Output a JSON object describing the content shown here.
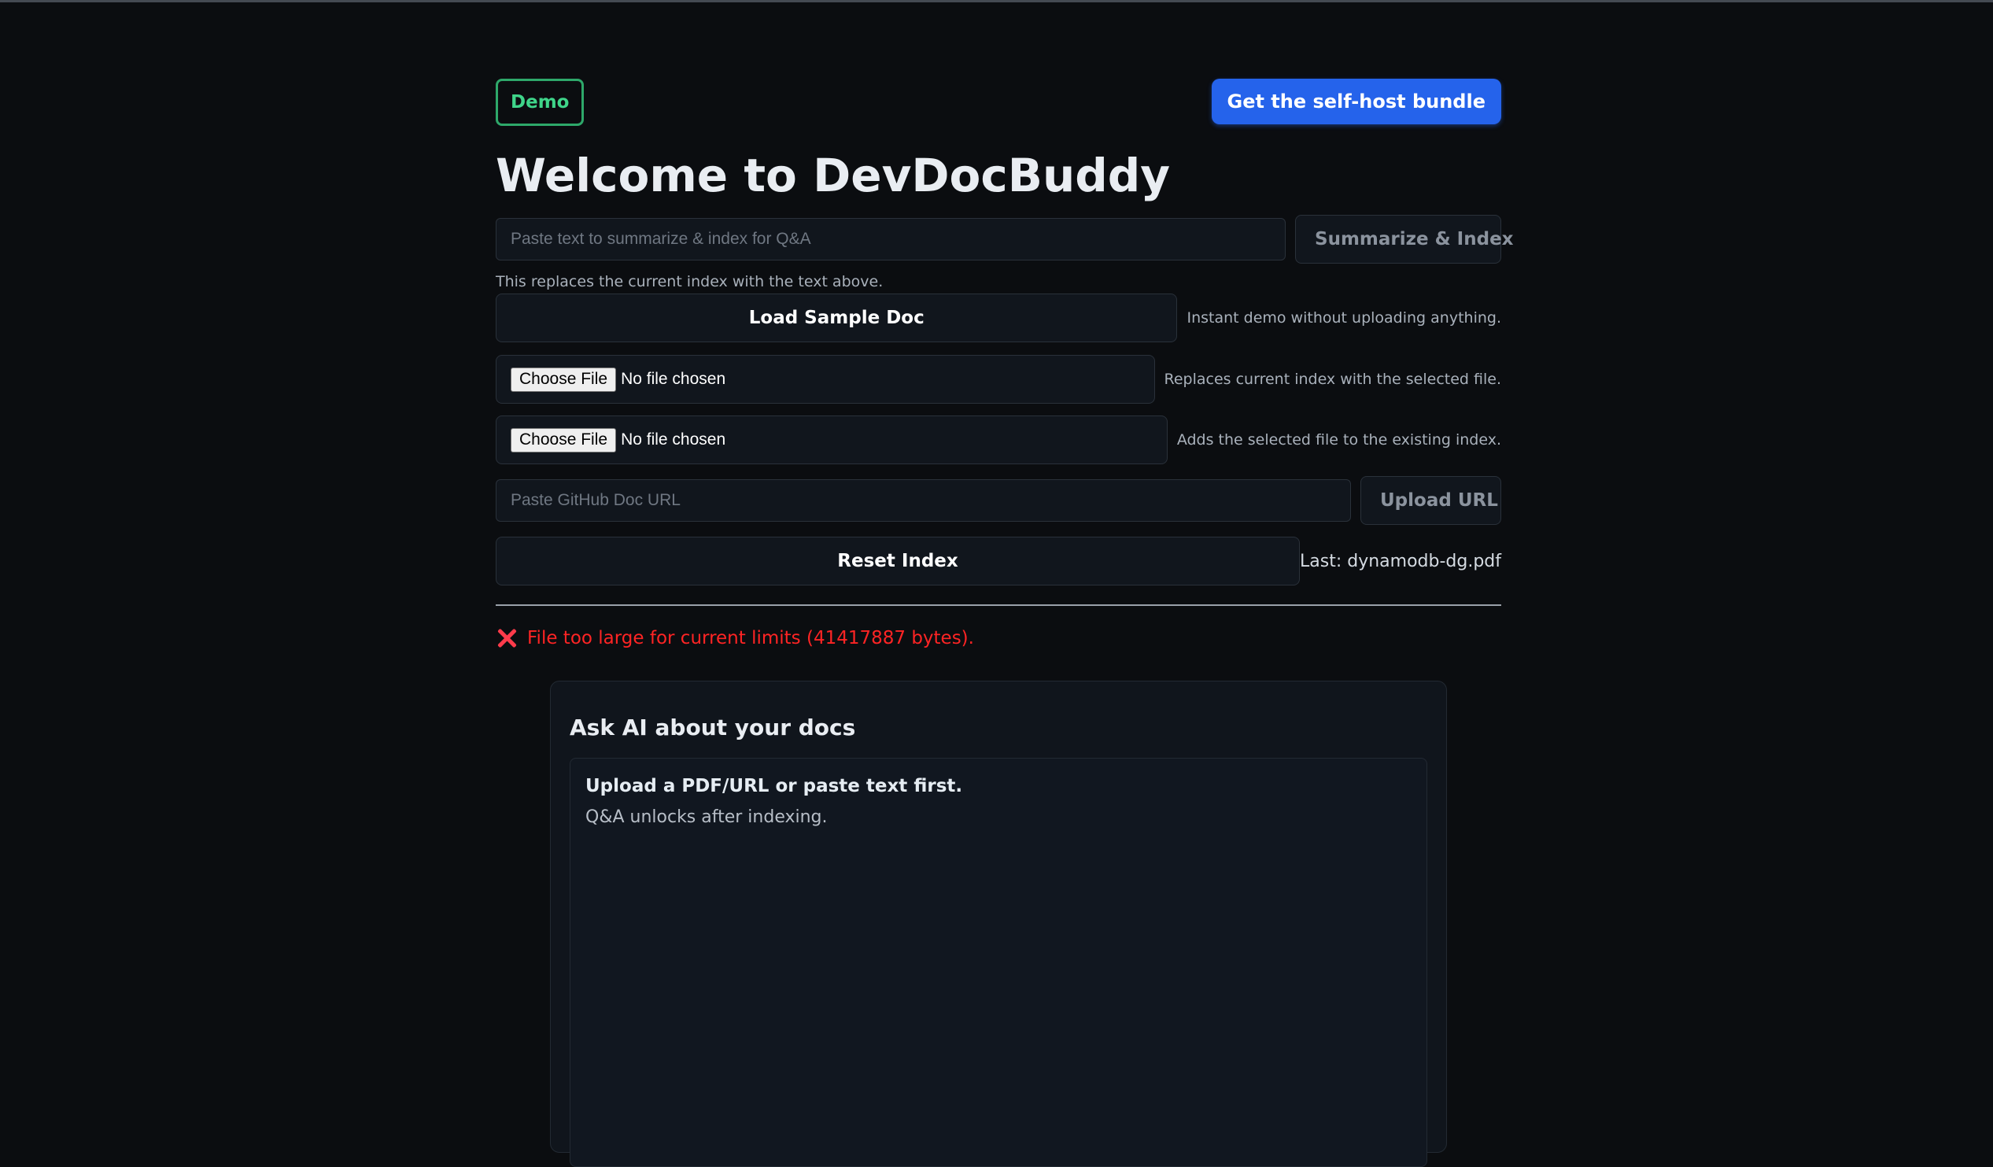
{
  "header": {
    "badge": "Demo",
    "cta_label": "Get the self-host bundle"
  },
  "page_title": "Welcome to DevDocBuddy",
  "summarize": {
    "placeholder": "Paste text to summarize & index for Q&A",
    "button_label": "Summarize & Index",
    "hint": "This replaces the current index with the text above."
  },
  "sample": {
    "button_label": "Load Sample Doc",
    "hint": "Instant demo without uploading anything."
  },
  "file_replace": {
    "choose_label": "Choose File",
    "status": "No file chosen",
    "hint": "Replaces current index with the selected file."
  },
  "file_add": {
    "choose_label": "Choose File",
    "status": "No file chosen",
    "hint": "Adds the selected file to the existing index."
  },
  "url_upload": {
    "placeholder": "Paste GitHub Doc URL",
    "button_label": "Upload URL"
  },
  "reset": {
    "button_label": "Reset Index",
    "last_label": "Last: dynamodb-dg.pdf"
  },
  "error": {
    "message": "File too large for current limits (41417887 bytes)."
  },
  "ask_card": {
    "title": "Ask AI about your docs",
    "notice_strong": "Upload a PDF/URL or paste text first.",
    "notice_sub": "Q&A unlocks after indexing."
  },
  "colors": {
    "background": "#0b0d10",
    "accent_blue": "#2563eb",
    "badge_green": "#2ea86a",
    "error_red": "#ff2424"
  }
}
